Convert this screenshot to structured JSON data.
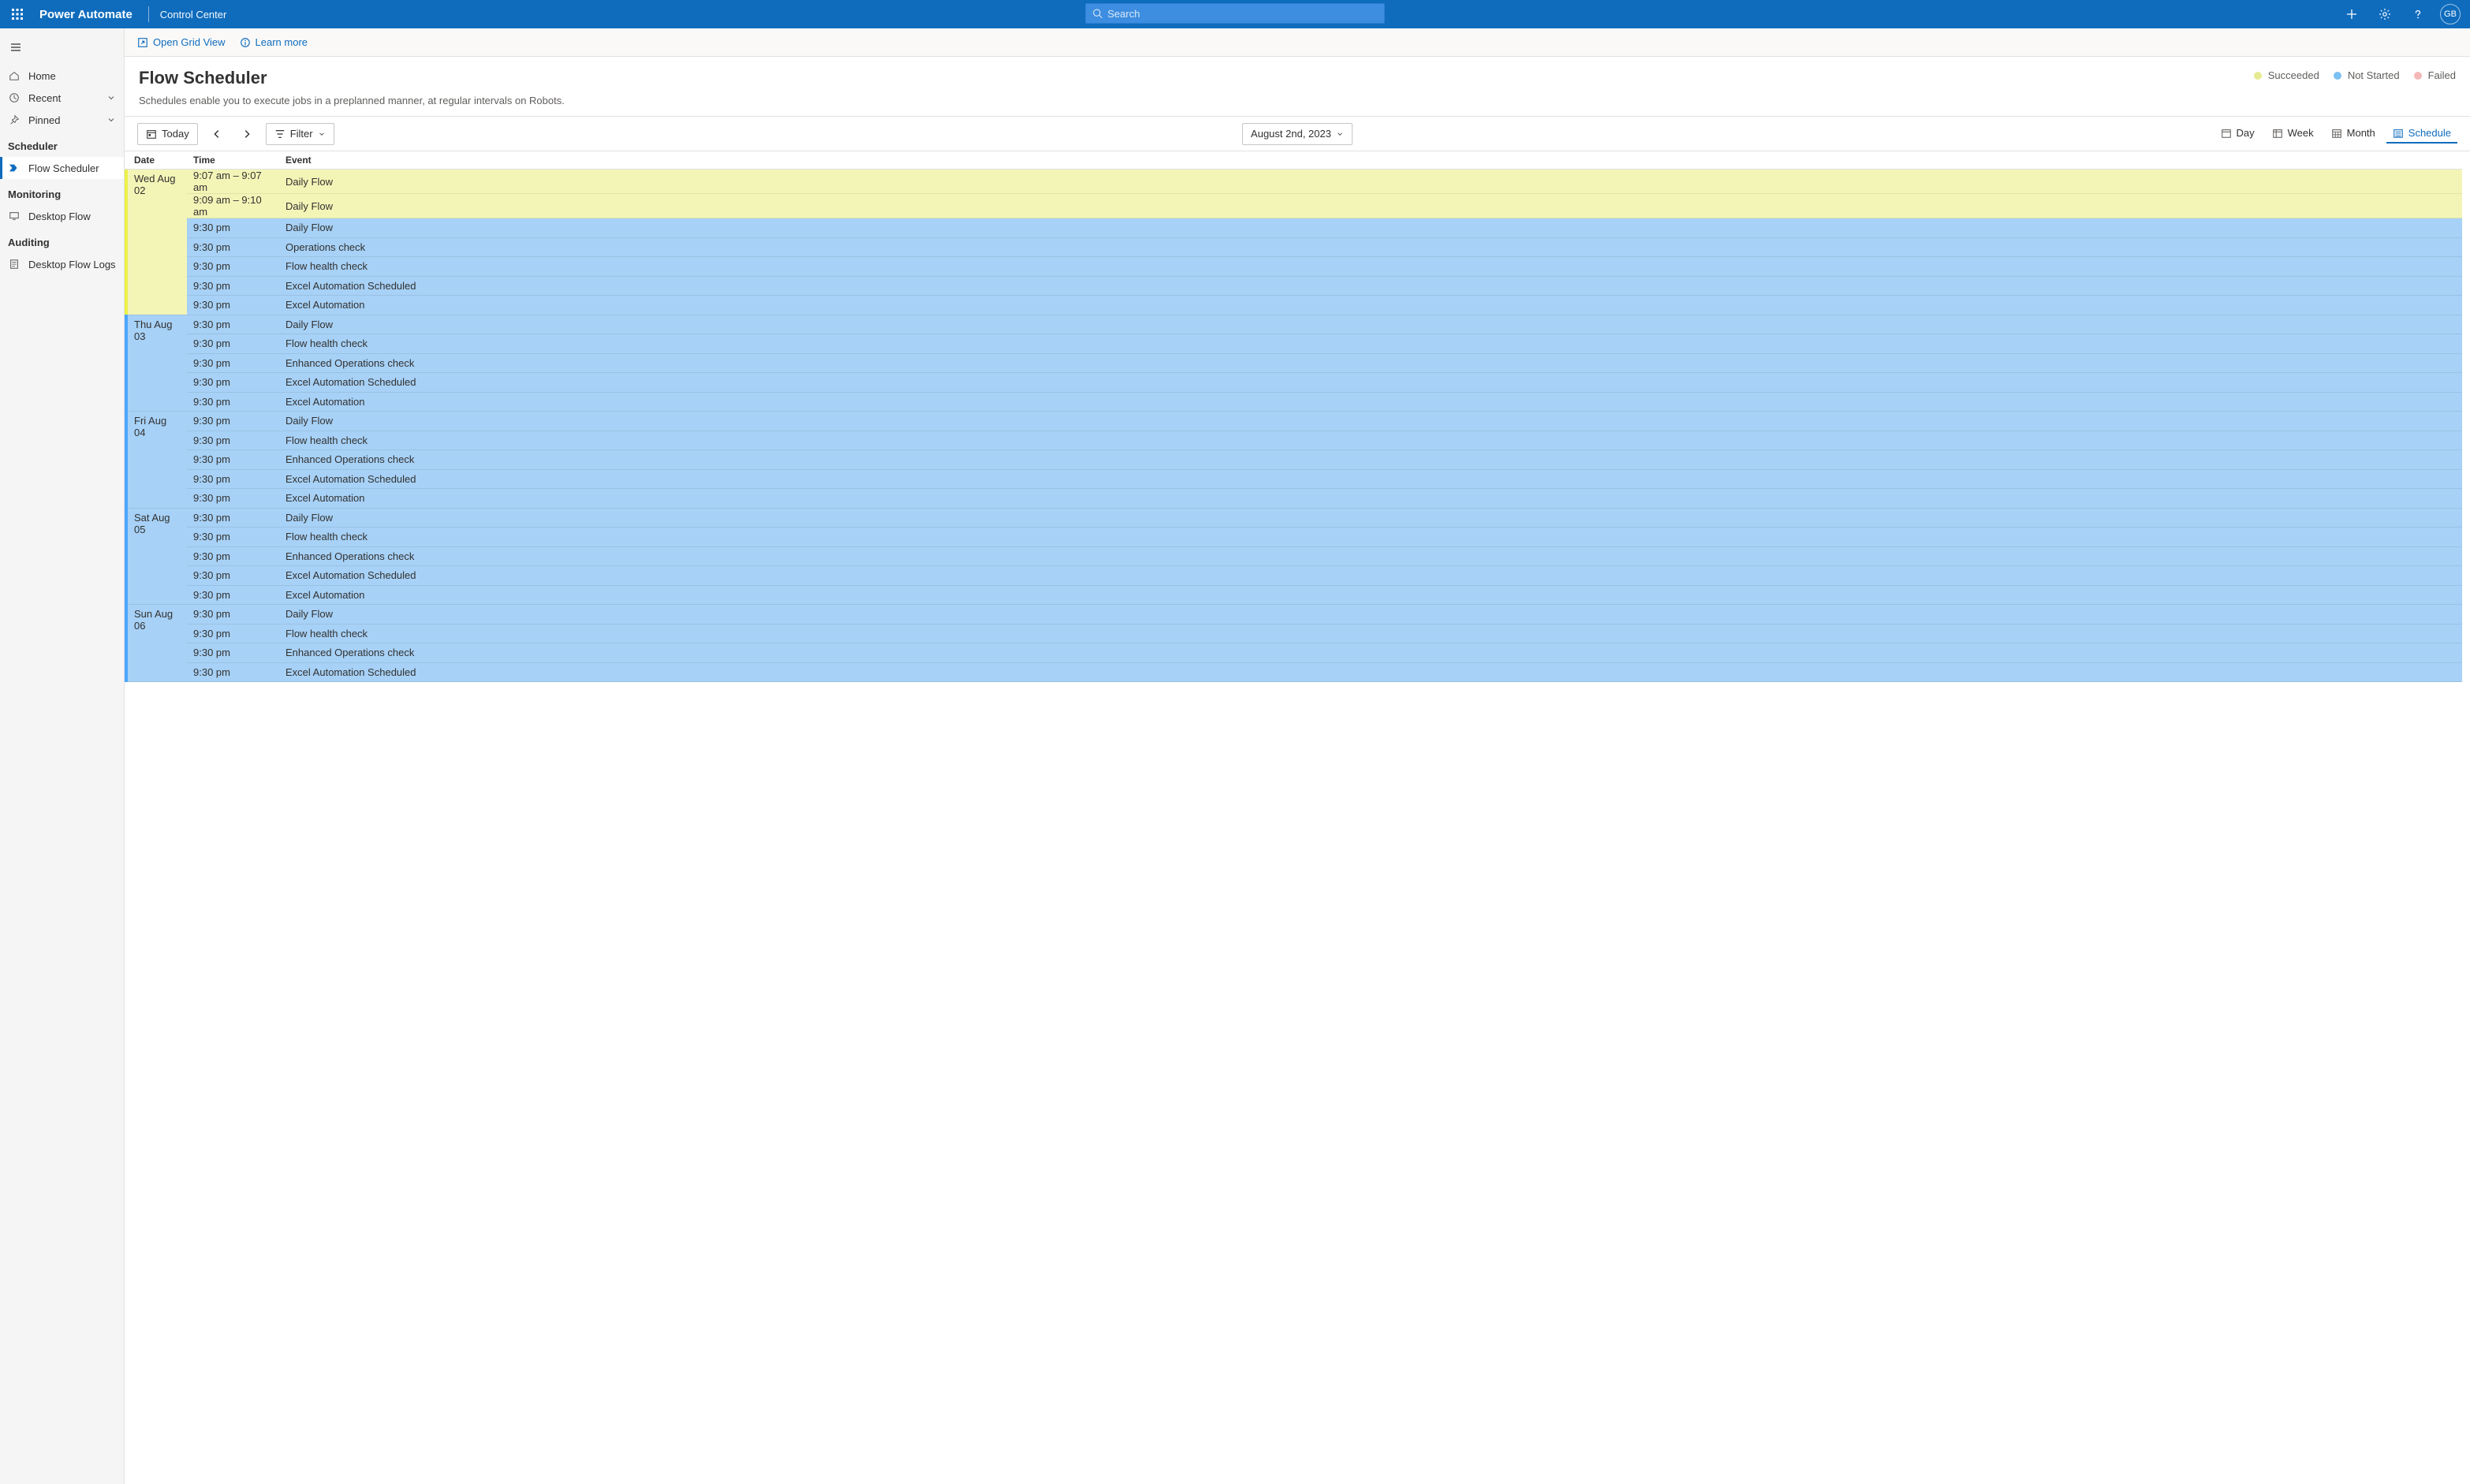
{
  "topbar": {
    "brand": "Power Automate",
    "breadcrumb": "Control Center",
    "search_placeholder": "Search",
    "avatar_initials": "GB"
  },
  "sidebar": {
    "home": "Home",
    "recent": "Recent",
    "pinned": "Pinned",
    "section_scheduler": "Scheduler",
    "flow_scheduler": "Flow Scheduler",
    "section_monitoring": "Monitoring",
    "desktop_flow": "Desktop Flow",
    "section_auditing": "Auditing",
    "desktop_flow_logs": "Desktop Flow Logs"
  },
  "commandbar": {
    "open_grid_view": "Open Grid View",
    "learn_more": "Learn more"
  },
  "header": {
    "title": "Flow Scheduler",
    "subtitle": "Schedules enable you to execute jobs in a preplanned manner, at regular intervals on Robots."
  },
  "legend": {
    "succeeded": {
      "label": "Succeeded",
      "color": "#e6ea93"
    },
    "not_started": {
      "label": "Not Started",
      "color": "#7cc0f4"
    },
    "failed": {
      "label": "Failed",
      "color": "#f4b8b8"
    }
  },
  "toolbar": {
    "today": "Today",
    "filter": "Filter",
    "date_display": "August 2nd, 2023",
    "views": {
      "day": "Day",
      "week": "Week",
      "month": "Month",
      "schedule": "Schedule"
    }
  },
  "grid": {
    "headers": {
      "date": "Date",
      "time": "Time",
      "event": "Event"
    },
    "days": [
      {
        "date_label": "Wed Aug 02",
        "day_status": "succeeded",
        "rows": [
          {
            "time": "9:07 am – 9:07 am",
            "event": "Daily Flow",
            "status": "succeeded"
          },
          {
            "time": "9:09 am – 9:10 am",
            "event": "Daily Flow",
            "status": "succeeded"
          },
          {
            "time": "9:30 pm",
            "event": "Daily Flow",
            "status": "notstarted"
          },
          {
            "time": "9:30 pm",
            "event": "Operations check",
            "status": "notstarted"
          },
          {
            "time": "9:30 pm",
            "event": "Flow health check",
            "status": "notstarted"
          },
          {
            "time": "9:30 pm",
            "event": "Excel Automation Scheduled",
            "status": "notstarted"
          },
          {
            "time": "9:30 pm",
            "event": "Excel Automation",
            "status": "notstarted"
          }
        ]
      },
      {
        "date_label": "Thu Aug 03",
        "day_status": "notstarted",
        "rows": [
          {
            "time": "9:30 pm",
            "event": "Daily Flow",
            "status": "notstarted"
          },
          {
            "time": "9:30 pm",
            "event": "Flow health check",
            "status": "notstarted"
          },
          {
            "time": "9:30 pm",
            "event": "Enhanced Operations check",
            "status": "notstarted"
          },
          {
            "time": "9:30 pm",
            "event": "Excel Automation Scheduled",
            "status": "notstarted"
          },
          {
            "time": "9:30 pm",
            "event": "Excel Automation",
            "status": "notstarted"
          }
        ]
      },
      {
        "date_label": "Fri Aug 04",
        "day_status": "notstarted",
        "rows": [
          {
            "time": "9:30 pm",
            "event": "Daily Flow",
            "status": "notstarted"
          },
          {
            "time": "9:30 pm",
            "event": "Flow health check",
            "status": "notstarted"
          },
          {
            "time": "9:30 pm",
            "event": "Enhanced Operations check",
            "status": "notstarted"
          },
          {
            "time": "9:30 pm",
            "event": "Excel Automation Scheduled",
            "status": "notstarted"
          },
          {
            "time": "9:30 pm",
            "event": "Excel Automation",
            "status": "notstarted"
          }
        ]
      },
      {
        "date_label": "Sat Aug 05",
        "day_status": "notstarted",
        "rows": [
          {
            "time": "9:30 pm",
            "event": "Daily Flow",
            "status": "notstarted"
          },
          {
            "time": "9:30 pm",
            "event": "Flow health check",
            "status": "notstarted"
          },
          {
            "time": "9:30 pm",
            "event": "Enhanced Operations check",
            "status": "notstarted"
          },
          {
            "time": "9:30 pm",
            "event": "Excel Automation Scheduled",
            "status": "notstarted"
          },
          {
            "time": "9:30 pm",
            "event": "Excel Automation",
            "status": "notstarted"
          }
        ]
      },
      {
        "date_label": "Sun Aug 06",
        "day_status": "notstarted",
        "rows": [
          {
            "time": "9:30 pm",
            "event": "Daily Flow",
            "status": "notstarted"
          },
          {
            "time": "9:30 pm",
            "event": "Flow health check",
            "status": "notstarted"
          },
          {
            "time": "9:30 pm",
            "event": "Enhanced Operations check",
            "status": "notstarted"
          },
          {
            "time": "9:30 pm",
            "event": "Excel Automation Scheduled",
            "status": "notstarted"
          }
        ]
      }
    ]
  }
}
